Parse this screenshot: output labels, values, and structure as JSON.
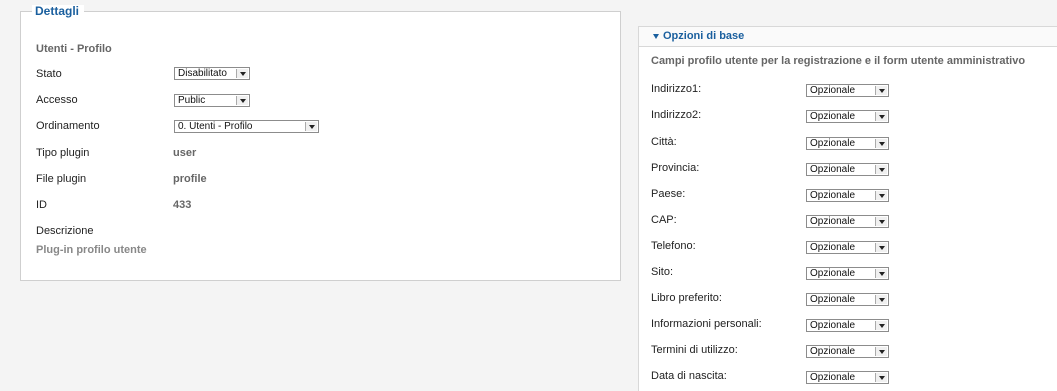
{
  "details": {
    "legend": "Dettagli",
    "subtitle": "Utenti - Profilo",
    "fields": [
      {
        "label": "Stato",
        "type": "select",
        "value": "Disabilitato"
      },
      {
        "label": "Accesso",
        "type": "select",
        "value": "Public"
      },
      {
        "label": "Ordinamento",
        "type": "select",
        "value": "0. Utenti - Profilo"
      },
      {
        "label": "Tipo plugin",
        "type": "text",
        "value": "user"
      },
      {
        "label": "File plugin",
        "type": "text",
        "value": "profile"
      },
      {
        "label": "ID",
        "type": "text",
        "value": "433"
      },
      {
        "label": "Descrizione",
        "type": "text",
        "value": ""
      }
    ],
    "description_text": "Plug-in profilo utente"
  },
  "options": {
    "title": "Opzioni di base",
    "description": "Campi profilo utente per la registrazione e il form utente amministrativo",
    "fields": [
      {
        "label": "Indirizzo1:",
        "value": "Opzionale"
      },
      {
        "label": "Indirizzo2:",
        "value": "Opzionale"
      },
      {
        "label": "Città:",
        "value": "Opzionale"
      },
      {
        "label": "Provincia:",
        "value": "Opzionale"
      },
      {
        "label": "Paese:",
        "value": "Opzionale"
      },
      {
        "label": "CAP:",
        "value": "Opzionale"
      },
      {
        "label": "Telefono:",
        "value": "Opzionale"
      },
      {
        "label": "Sito:",
        "value": "Opzionale"
      },
      {
        "label": "Libro preferito:",
        "value": "Opzionale"
      },
      {
        "label": "Informazioni personali:",
        "value": "Opzionale"
      },
      {
        "label": "Termini di utilizzo:",
        "value": "Opzionale"
      },
      {
        "label": "Data di nascita:",
        "value": "Opzionale"
      }
    ]
  },
  "colors": {
    "accent": "#1a5f9e",
    "panel_bg": "#ffffff",
    "page_bg": "#f4f4f4"
  },
  "icons": {
    "panel_toggle": "triangle-down-icon",
    "select_arrow": "chevron-down-icon"
  }
}
